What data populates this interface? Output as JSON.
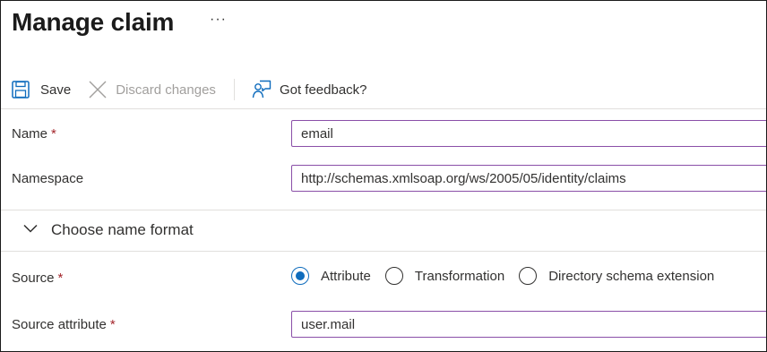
{
  "page": {
    "title": "Manage claim",
    "more_icon": "more-horizontal-icon"
  },
  "toolbar": {
    "save_label": "Save",
    "save_icon": "save-icon",
    "discard_label": "Discard changes",
    "discard_icon": "close-icon",
    "discard_enabled": false,
    "feedback_label": "Got feedback?",
    "feedback_icon": "feedback-icon"
  },
  "form": {
    "name": {
      "label": "Name",
      "required_mark": "*",
      "value": "email"
    },
    "namespace": {
      "label": "Namespace",
      "value": "http://schemas.xmlsoap.org/ws/2005/05/identity/claims"
    },
    "name_format_section": {
      "label": "Choose name format",
      "icon": "chevron-down-icon"
    },
    "source": {
      "label": "Source",
      "required_mark": "*",
      "options": [
        {
          "label": "Attribute",
          "selected": true
        },
        {
          "label": "Transformation",
          "selected": false
        },
        {
          "label": "Directory schema extension",
          "selected": false
        }
      ]
    },
    "source_attribute": {
      "label": "Source attribute",
      "required_mark": "*",
      "value": "user.mail"
    }
  },
  "colors": {
    "accent": "#0f6cbd",
    "input_border": "#8a4fa8",
    "required": "#a4262c",
    "disabled_text": "#a19f9d"
  }
}
